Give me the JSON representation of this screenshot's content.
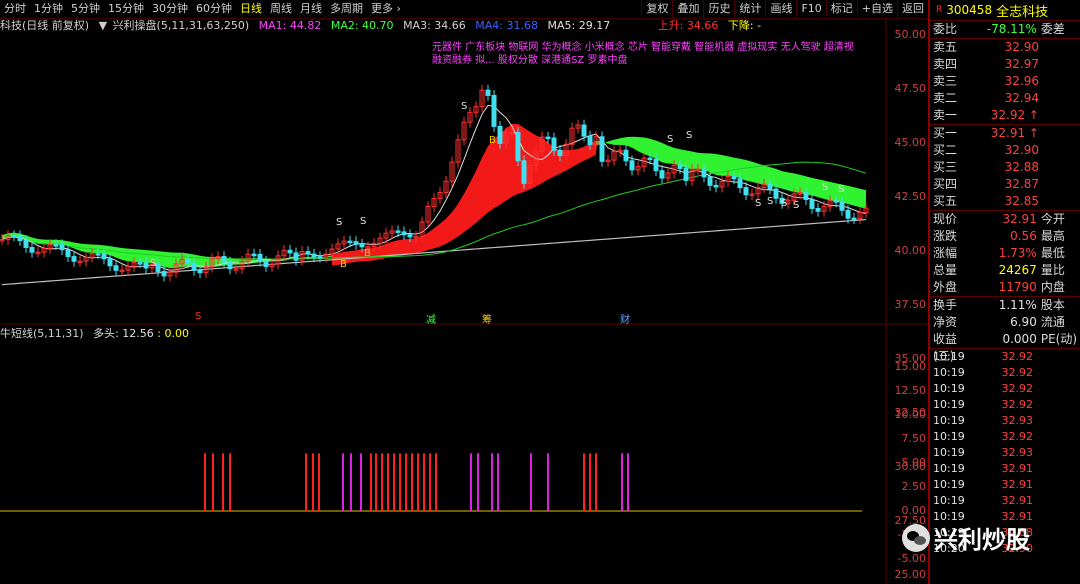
{
  "toolbar": {
    "tabs": [
      "分时",
      "1分钟",
      "5分钟",
      "15分钟",
      "30分钟",
      "60分钟",
      "日线",
      "周线",
      "月线",
      "多周期",
      "更多 ›"
    ],
    "active": "日线",
    "right": [
      "复权",
      "叠加",
      "历史",
      "统计",
      "画线",
      "F10",
      "标记",
      "+自选",
      "返回"
    ]
  },
  "legend": {
    "title": "科技(日线 前复权)",
    "indicator": "兴利操盘(5,11,31,63,250)",
    "ma1": "MA1: 44.82",
    "ma2": "MA2: 40.70",
    "ma3": "MA3: 34.66",
    "ma4": "MA4: 31.68",
    "ma5": "MA5: 29.17",
    "up": "上升: 34.66",
    "down": "下降: -"
  },
  "concepts": {
    "line1": "元器件 广东板块 物联网 华为概念 小米概念 芯片 智能穿戴 智能机器 虚拟现实 无人驾驶 超清视",
    "line2": "融资融券 拟... 股权分散 深港通SZ 罗素中盘"
  },
  "markers": {
    "s": "S",
    "b": "B",
    "s_bottom": "S",
    "jian": "减",
    "chou": "筹",
    "cai": "财"
  },
  "sub_legend": {
    "name": "牛短线(5,11,31)",
    "duotou": "多头: 12.56",
    "value": ": 0.00"
  },
  "axis": {
    "price": [
      "50.00",
      "47.50",
      "45.00",
      "42.50",
      "40.00",
      "37.50",
      "35.00",
      "32.50",
      "30.00",
      "27.50",
      "25.00"
    ],
    "sub": [
      "15.00",
      "12.50",
      "10.00",
      "7.50",
      "5.00",
      "2.50",
      "0.00",
      "-2.50",
      "-5.00"
    ]
  },
  "colors": {
    "up": "#ff3030",
    "down": "#40e0f0",
    "band_green": "#33ff33",
    "band_red": "#ff1a1a",
    "bars_red": "#ff2020",
    "bars_magenta": "#e020e0",
    "zero": "#e0c000"
  },
  "stock": {
    "badge": "R",
    "code": "300458",
    "name": "全志科技"
  },
  "weibi": {
    "label": "委比",
    "value": "-78.11%",
    "extra": "委差"
  },
  "asks": [
    {
      "label": "卖五",
      "price": "32.90"
    },
    {
      "label": "卖四",
      "price": "32.97"
    },
    {
      "label": "卖三",
      "price": "32.96"
    },
    {
      "label": "卖二",
      "price": "32.94"
    },
    {
      "label": "卖一",
      "price": "32.92 ↑"
    }
  ],
  "bids": [
    {
      "label": "买一",
      "price": "32.91 ↑"
    },
    {
      "label": "买二",
      "price": "32.90"
    },
    {
      "label": "买三",
      "price": "32.88"
    },
    {
      "label": "买四",
      "price": "32.87"
    },
    {
      "label": "买五",
      "price": "32.85"
    }
  ],
  "quote": [
    {
      "label": "现价",
      "value": "32.91",
      "extra": "今开",
      "vcolor": "#ff4040"
    },
    {
      "label": "涨跌",
      "value": "0.56",
      "extra": "最高",
      "vcolor": "#ff4040"
    },
    {
      "label": "涨幅",
      "value": "1.73%",
      "extra": "最低",
      "vcolor": "#ff4040"
    },
    {
      "label": "总量",
      "value": "24267",
      "extra": "量比",
      "vcolor": "#ffff00"
    },
    {
      "label": "外盘",
      "value": "11790",
      "extra": "内盘",
      "vcolor": "#ff4040"
    }
  ],
  "stats": [
    {
      "label": "换手",
      "value": "1.11%",
      "extra": "股本"
    },
    {
      "label": "净资",
      "value": "6.90",
      "extra": "流通"
    },
    {
      "label": "收益(三)",
      "value": "0.000",
      "extra": "PE(动)"
    }
  ],
  "ticks": [
    {
      "time": "10:19",
      "price": "32.92"
    },
    {
      "time": "10:19",
      "price": "32.92"
    },
    {
      "time": "10:19",
      "price": "32.92"
    },
    {
      "time": "10:19",
      "price": "32.92"
    },
    {
      "time": "10:19",
      "price": "32.93"
    },
    {
      "time": "10:19",
      "price": "32.92"
    },
    {
      "time": "10:19",
      "price": "32.93"
    },
    {
      "time": "10:19",
      "price": "32.91"
    },
    {
      "time": "10:19",
      "price": "32.91"
    },
    {
      "time": "10:19",
      "price": "32.91"
    },
    {
      "time": "10:19",
      "price": "32.91"
    },
    {
      "time": "10:19",
      "price": "32.88"
    },
    {
      "time": "10:20",
      "price": "32.90"
    }
  ],
  "watermark": "兴利炒股"
}
